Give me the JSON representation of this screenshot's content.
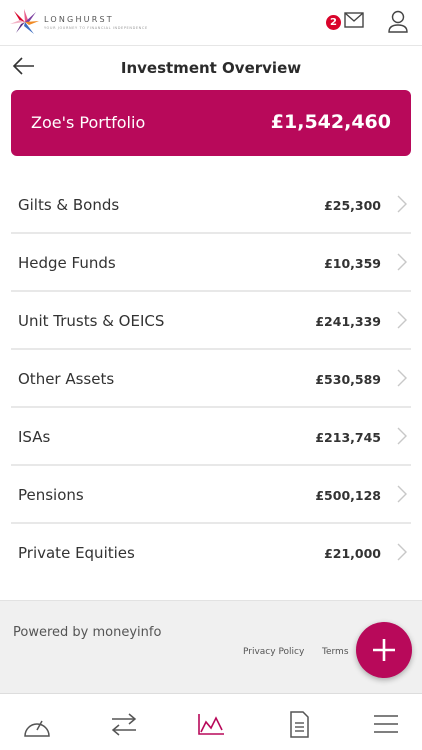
{
  "header": {
    "brand_name": "LONGHURST",
    "brand_tagline": "YOUR JOURNEY TO FINANCIAL INDEPENDENCE",
    "message_count": "2",
    "brand_color": "#b8095a",
    "badge_color": "#d9042b"
  },
  "title": "Investment Overview",
  "portfolio": {
    "name": "Zoe's Portfolio",
    "total": "£1,542,460"
  },
  "holdings": [
    {
      "label": "Gilts & Bonds",
      "value": "£25,300"
    },
    {
      "label": "Hedge Funds",
      "value": "£10,359"
    },
    {
      "label": "Unit Trusts & OEICS",
      "value": "£241,339"
    },
    {
      "label": "Other Assets",
      "value": "£530,589"
    },
    {
      "label": "ISAs",
      "value": "£213,745"
    },
    {
      "label": "Pensions",
      "value": "£500,128"
    },
    {
      "label": "Private Equities",
      "value": "£21,000"
    }
  ],
  "footer": {
    "powered_by": "Powered by moneyinfo",
    "privacy": "Privacy Policy",
    "terms": "Terms"
  },
  "nav": {
    "items": [
      "dashboard-icon",
      "transfer-icon",
      "chart-icon",
      "document-icon",
      "menu-icon"
    ],
    "active": "chart-icon"
  }
}
